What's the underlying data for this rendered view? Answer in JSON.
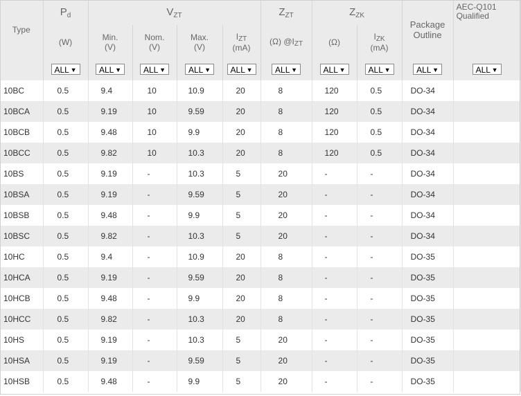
{
  "headers": {
    "type": "Type",
    "pd": "P",
    "pd_sub": "d",
    "pd_unit": "(W)",
    "vzt": "V",
    "vzt_sub": "ZT",
    "min": "Min.",
    "min_unit": "(V)",
    "nom": "Nom.",
    "nom_unit": "(V)",
    "max": "Max.",
    "max_unit": "(V)",
    "izt": "I",
    "izt_sub": "ZT",
    "izt_unit": "(mA)",
    "zzt": "Z",
    "zzt_sub": "ZT",
    "zzt_unit_a": "(Ω) @I",
    "zzt_unit_sub": "ZT",
    "zzk": "Z",
    "zzk_sub": "ZK",
    "zzk_unit": "(Ω)",
    "izk": "I",
    "izk_sub": "ZK",
    "izk_unit": "(mA)",
    "package": "Package Outline",
    "aec": "AEC-Q101 Qualified"
  },
  "filter_label": "ALL",
  "rows": [
    [
      "10BC",
      "0.5",
      "9.4",
      "10",
      "10.9",
      "20",
      "8",
      "120",
      "0.5",
      "DO-34",
      ""
    ],
    [
      "10BCA",
      "0.5",
      "9.19",
      "10",
      "9.59",
      "20",
      "8",
      "120",
      "0.5",
      "DO-34",
      ""
    ],
    [
      "10BCB",
      "0.5",
      "9.48",
      "10",
      "9.9",
      "20",
      "8",
      "120",
      "0.5",
      "DO-34",
      ""
    ],
    [
      "10BCC",
      "0.5",
      "9.82",
      "10",
      "10.3",
      "20",
      "8",
      "120",
      "0.5",
      "DO-34",
      ""
    ],
    [
      "10BS",
      "0.5",
      "9.19",
      "-",
      "10.3",
      "5",
      "20",
      "-",
      "-",
      "DO-34",
      ""
    ],
    [
      "10BSA",
      "0.5",
      "9.19",
      "-",
      "9.59",
      "5",
      "20",
      "-",
      "-",
      "DO-34",
      ""
    ],
    [
      "10BSB",
      "0.5",
      "9.48",
      "-",
      "9.9",
      "5",
      "20",
      "-",
      "-",
      "DO-34",
      ""
    ],
    [
      "10BSC",
      "0.5",
      "9.82",
      "-",
      "10.3",
      "5",
      "20",
      "-",
      "-",
      "DO-34",
      ""
    ],
    [
      "10HC",
      "0.5",
      "9.4",
      "-",
      "10.9",
      "20",
      "8",
      "-",
      "-",
      "DO-35",
      ""
    ],
    [
      "10HCA",
      "0.5",
      "9.19",
      "-",
      "9.59",
      "20",
      "8",
      "-",
      "-",
      "DO-35",
      ""
    ],
    [
      "10HCB",
      "0.5",
      "9.48",
      "-",
      "9.9",
      "20",
      "8",
      "-",
      "-",
      "DO-35",
      ""
    ],
    [
      "10HCC",
      "0.5",
      "9.82",
      "-",
      "10.3",
      "20",
      "8",
      "-",
      "-",
      "DO-35",
      ""
    ],
    [
      "10HS",
      "0.5",
      "9.19",
      "-",
      "10.3",
      "5",
      "20",
      "-",
      "-",
      "DO-35",
      ""
    ],
    [
      "10HSA",
      "0.5",
      "9.19",
      "-",
      "9.59",
      "5",
      "20",
      "-",
      "-",
      "DO-35",
      ""
    ],
    [
      "10HSB",
      "0.5",
      "9.48",
      "-",
      "9.9",
      "5",
      "20",
      "-",
      "-",
      "DO-35",
      ""
    ]
  ]
}
